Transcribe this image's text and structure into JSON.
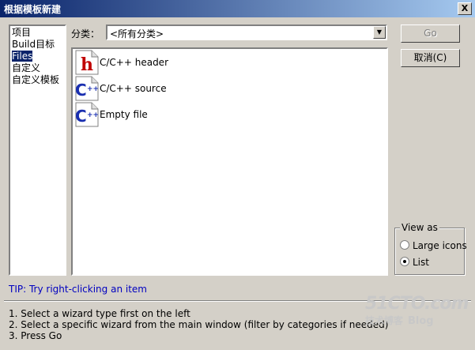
{
  "window": {
    "title": "根据模板新建",
    "close_label": "X"
  },
  "left_list": {
    "items": [
      "项目",
      "Build目标",
      "Files",
      "自定义",
      "自定义模板"
    ],
    "selected": "Files"
  },
  "category": {
    "label": "分类：",
    "value": "<所有分类>"
  },
  "wizards": [
    {
      "icon": "h-header-icon",
      "label": "C/C++ header"
    },
    {
      "icon": "cpp-source-icon",
      "label": "C/C++ source"
    },
    {
      "icon": "cpp-source-icon",
      "label": "Empty file"
    }
  ],
  "buttons": {
    "go": "Go",
    "cancel": "取消(C)"
  },
  "view_as": {
    "title": "View as",
    "options": [
      "Large icons",
      "List"
    ],
    "selected": "List"
  },
  "tip": "TIP: Try right-clicking an item",
  "instructions": [
    "1. Select a wizard type first on the left",
    "2. Select a specific wizard from the main window (filter by categories if needed)",
    "3. Press Go"
  ],
  "watermark": {
    "brand": "51CTO.com",
    "sub": "技术博客",
    "blog": "Blog"
  },
  "colors": {
    "titlebar_start": "#0a246a",
    "titlebar_end": "#a6caf0",
    "selection": "#0a246a",
    "tip": "#0000c0"
  }
}
